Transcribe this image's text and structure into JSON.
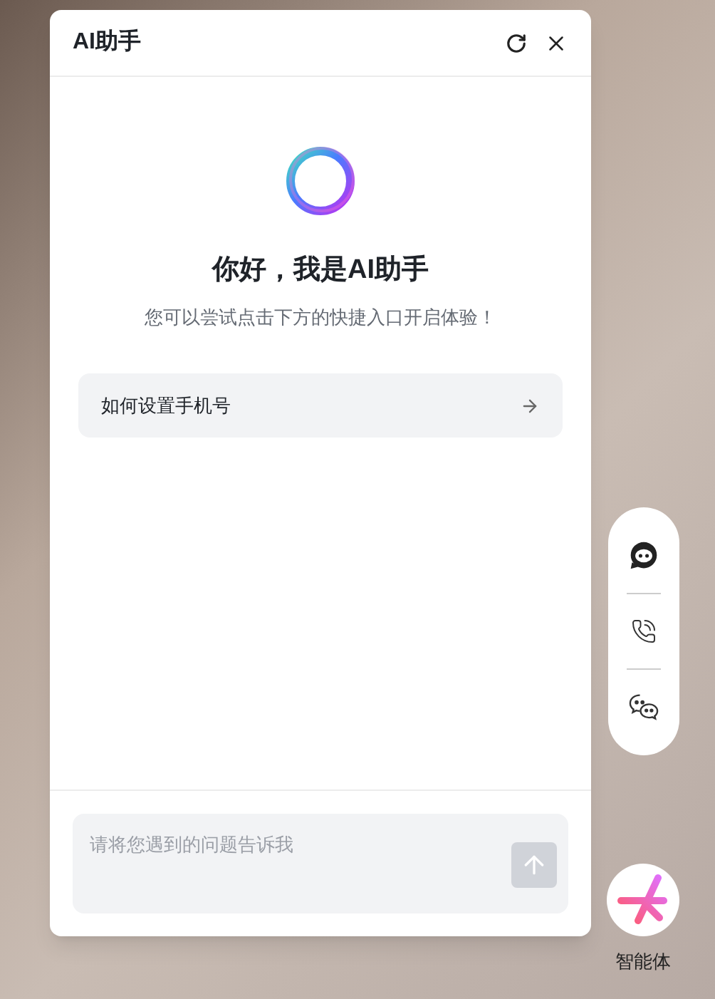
{
  "panel": {
    "title": "AI助手"
  },
  "welcome": {
    "heading": "你好，我是AI助手",
    "subtitle": "您可以尝试点击下方的快捷入口开启体验！"
  },
  "quick_entries": [
    {
      "label": "如何设置手机号"
    }
  ],
  "input": {
    "placeholder": "请将您遇到的问题告诉我",
    "send_disabled": true
  },
  "side_toolbar": [
    {
      "kind": "bot"
    },
    {
      "kind": "phone"
    },
    {
      "kind": "wechat"
    }
  ],
  "agent": {
    "label": "智能体"
  }
}
